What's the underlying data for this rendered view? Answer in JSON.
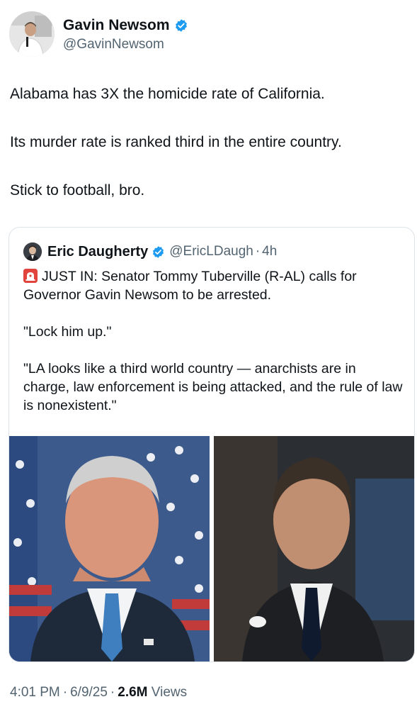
{
  "author": {
    "name": "Gavin Newsom",
    "handle": "@GavinNewsom",
    "verified_color": "#1d9bf0"
  },
  "tweet": {
    "paragraphs": [
      "Alabama has 3X the homicide rate of California.",
      "Its murder rate is ranked third in the entire country.",
      "Stick to football, bro."
    ]
  },
  "quoted_tweet": {
    "author_name": "Eric Daugherty",
    "handle": "@EricLDaugh",
    "separator": "·",
    "time": "4h",
    "icon": "siren-icon",
    "lines": [
      "JUST IN: Senator Tommy Tuberville (R-AL) calls for Governor Gavin Newsom to be arrested.",
      "\"Lock him up.\"",
      "\"LA looks like a third world country — anarchists are in charge, law enforcement is being attacked, and the rule of law is nonexistent.\""
    ],
    "images": [
      "photo-senator",
      "photo-governor"
    ]
  },
  "meta": {
    "time": "4:01 PM",
    "date": "6/9/25",
    "separator": "·",
    "views_count": "2.6M",
    "views_label": "Views"
  }
}
